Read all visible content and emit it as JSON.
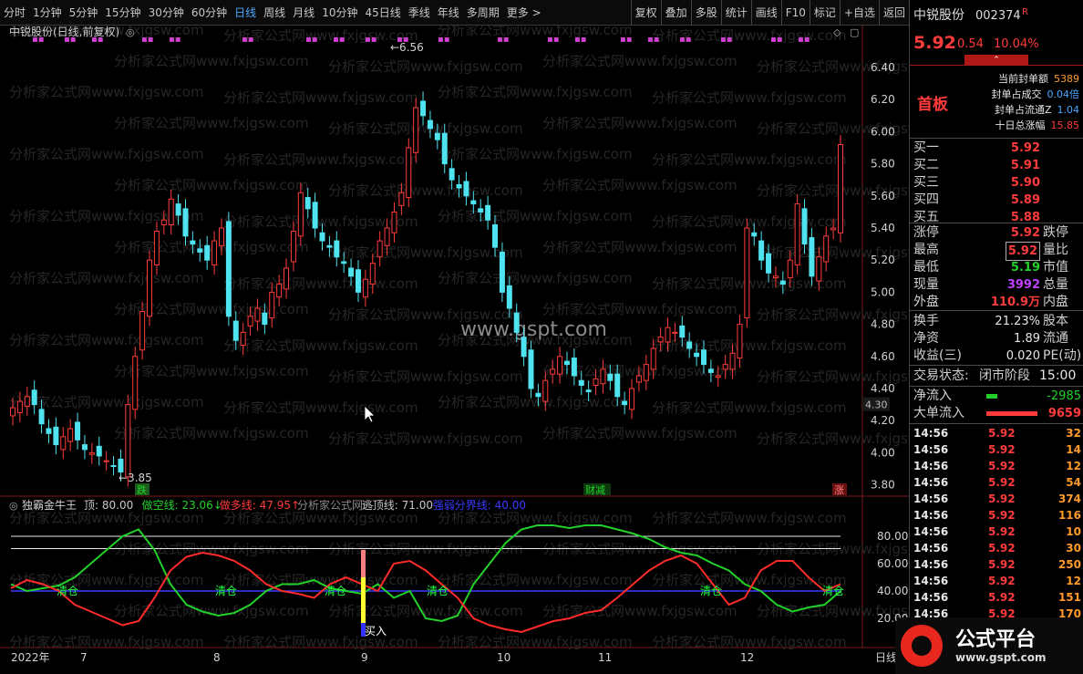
{
  "toolbar": {
    "periods": [
      "分时",
      "1分钟",
      "5分钟",
      "15分钟",
      "30分钟",
      "60分钟",
      "日线",
      "周线",
      "月线",
      "10分钟",
      "45日线",
      "季线",
      "年线",
      "多周期",
      "更多 >"
    ],
    "active_period": "日线",
    "tools": [
      "复权",
      "叠加",
      "多股",
      "统计",
      "画线",
      "F10",
      "标记",
      "+自选",
      "返回"
    ]
  },
  "main_panel": {
    "title": "中锐股份(日线,前复权)",
    "price_axis": [
      "6.40",
      "6.20",
      "6.00",
      "5.80",
      "5.60",
      "5.40",
      "5.20",
      "5.00",
      "4.80",
      "4.60",
      "4.40",
      "4.20",
      "4.00",
      "3.80"
    ],
    "current_marker": "4.30",
    "high_label": "6.56",
    "low_label": "3.85",
    "signals": [
      "跌",
      "财减",
      "涨"
    ],
    "watermark_main": "www.gspt.com",
    "watermark_rep": "分析家公式网www.fxjgsw.com"
  },
  "indicator": {
    "name": "独霸金牛王",
    "params": [
      {
        "label": "顶: 80.00",
        "color": "#c8c8c8"
      },
      {
        "label": "做空线: 23.06↓",
        "color": "#22d12a"
      },
      {
        "label": "做多线: 47.95↑",
        "color": "#ff3b3b"
      },
      {
        "label": "分析家公式网: -",
        "color": "#8a8a8a"
      },
      {
        "label": "逃顶线: 71.00",
        "color": "#c8c8c8"
      },
      {
        "label": "强弱分界线: 40.00",
        "color": "#3a3aff"
      }
    ],
    "axis": [
      "80.00",
      "60.00",
      "40.00",
      "20.00"
    ],
    "signal_labels": [
      "清仓",
      "清仓",
      "清仓",
      "清仓",
      "清仓",
      "清仓"
    ],
    "buy_label": "买入"
  },
  "date_axis": [
    "2022年",
    "7",
    "8",
    "9",
    "10",
    "11",
    "12"
  ],
  "date_tag": "日线",
  "right_panel": {
    "stock_name": "中锐股份",
    "stock_code": "002374",
    "stock_flag": "R",
    "price": "5.92",
    "change": "0.54",
    "pct": "10.04%",
    "board": "首板",
    "board_info": [
      {
        "label": "当前封单额",
        "value": "5389"
      },
      {
        "label": "封单占成交",
        "value": "0.04倍"
      },
      {
        "label": "封单占流通Z",
        "value": "1.04"
      },
      {
        "label": "十日总涨幅",
        "value": "15.85"
      }
    ],
    "bids": [
      {
        "label": "买一",
        "price": "5.92"
      },
      {
        "label": "买二",
        "price": "5.91"
      },
      {
        "label": "买三",
        "price": "5.90"
      },
      {
        "label": "买四",
        "price": "5.89"
      },
      {
        "label": "买五",
        "price": "5.88"
      }
    ],
    "stats": [
      {
        "l1": "涨停",
        "v1": "5.92",
        "c1": "red",
        "l2": "跌停"
      },
      {
        "l1": "最高",
        "v1": "5.92",
        "c1": "red",
        "l2": "量比"
      },
      {
        "l1": "最低",
        "v1": "5.19",
        "c1": "grn",
        "l2": "市值"
      },
      {
        "l1": "现量",
        "v1": "3992",
        "c1": "pur",
        "l2": "总量"
      },
      {
        "l1": "外盘",
        "v1": "110.9万",
        "c1": "red",
        "l2": "内盘"
      }
    ],
    "stats2": [
      {
        "l1": "换手",
        "v1": "21.23%",
        "l2": "股本"
      },
      {
        "l1": "净资",
        "v1": "1.89",
        "l2": "流通"
      },
      {
        "l1": "收益(三)",
        "v1": "0.020",
        "l2": "PE(动)"
      }
    ],
    "trade_status_label": "交易状态:",
    "trade_status": "闭市阶段",
    "trade_time": "15:00",
    "net_inflow_label": "净流入",
    "net_inflow": "-2985",
    "big_inflow_label": "大单流入",
    "big_inflow": "9659",
    "ticks": [
      {
        "t": "14:56",
        "p": "5.92",
        "v": "32"
      },
      {
        "t": "14:56",
        "p": "5.92",
        "v": "14"
      },
      {
        "t": "14:56",
        "p": "5.92",
        "v": "12"
      },
      {
        "t": "14:56",
        "p": "5.92",
        "v": "54"
      },
      {
        "t": "14:56",
        "p": "5.92",
        "v": "374"
      },
      {
        "t": "14:56",
        "p": "5.92",
        "v": "116"
      },
      {
        "t": "14:56",
        "p": "5.92",
        "v": "10"
      },
      {
        "t": "14:56",
        "p": "5.92",
        "v": "30"
      },
      {
        "t": "14:56",
        "p": "5.92",
        "v": "250"
      },
      {
        "t": "14:56",
        "p": "5.92",
        "v": "12"
      },
      {
        "t": "14:56",
        "p": "5.92",
        "v": "151"
      },
      {
        "t": "14:56",
        "p": "5.92",
        "v": "170"
      }
    ]
  },
  "logo": {
    "title": "公式平台",
    "url": "www.gspt.com"
  },
  "colors": {
    "up": "#ff3b3b",
    "down": "#4fe3f0",
    "bull": "#ff2a2a",
    "bear": "#22d12a",
    "strength": "#3a3aff"
  }
}
